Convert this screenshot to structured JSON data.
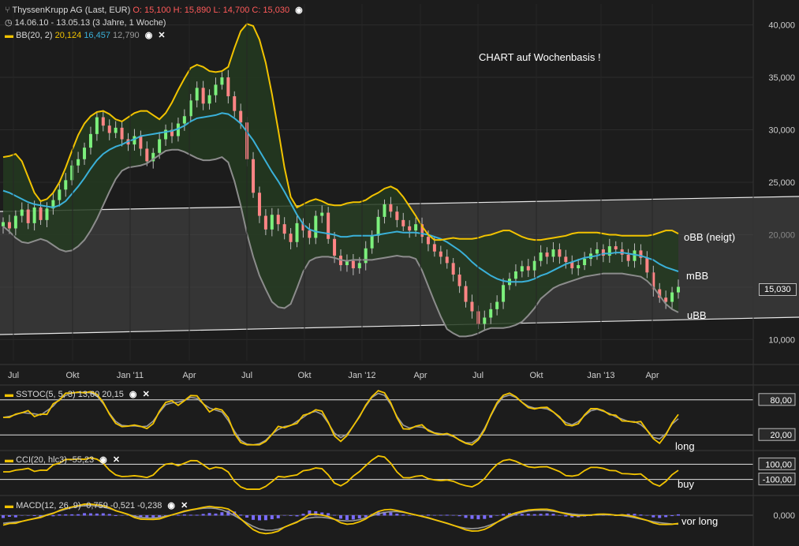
{
  "header": {
    "instrument": "ThyssenKrupp AG (Last, EUR)",
    "ohlc": "O: 15,100  H: 15,890  L: 14,700  C: 15,030",
    "range": "14.06.10 - 13.05.13 (3 Jahre, 1 Woche)",
    "bb_label": "BB(20, 2)",
    "bb_upper": "20,124",
    "bb_mid": "16,457",
    "bb_lower": "12,790"
  },
  "annotations": {
    "main": "CHART auf Wochenbasis !",
    "obb": "oBB (neigt)",
    "mbb": "mBB",
    "ubb": "uBB",
    "sstoc": "long",
    "cci": "buy",
    "macd": "vor long",
    "last_price": "15,030"
  },
  "indicators": {
    "sstoc": "SSTOC(5, 5, 3)  13,60  20,15",
    "cci": "CCI(20, hlc3)  -55,23",
    "macd": "MACD(12, 26, 9)  -0,759  -0,521  -0,238"
  },
  "colors": {
    "background": "#1c1c1c",
    "up": "#7cf07c",
    "down": "#ff8585",
    "bb_upper": "#f2c300",
    "bb_mid": "#3ab0d8",
    "bb_lower": "#8c8c8c",
    "band_fill": "#233a20",
    "channel_fill": "#4a4a4a"
  },
  "chart_data": [
    {
      "type": "candlestick",
      "x_ticks": [
        "Jul",
        "Okt",
        "Jan '11",
        "Apr",
        "Jul",
        "Okt",
        "Jan '12",
        "Apr",
        "Jul",
        "Okt",
        "Jan '13",
        "Apr"
      ],
      "y_ticks": [
        "10,000",
        "15,000",
        "20,000",
        "25,000",
        "30,000",
        "35,000",
        "40,000"
      ],
      "ylim": [
        8,
        42
      ],
      "close": [
        21.2,
        20.6,
        21.8,
        22.4,
        21.1,
        22.6,
        21.4,
        22.5,
        23.3,
        24.3,
        25.2,
        26.6,
        27.2,
        28.3,
        29.6,
        31.2,
        30.4,
        29.7,
        30.2,
        29.1,
        28.6,
        29.4,
        28.2,
        27.0,
        27.8,
        29.1,
        30.0,
        29.4,
        30.6,
        31.3,
        32.8,
        34.0,
        32.5,
        33.3,
        34.3,
        35.0,
        33.2,
        31.8,
        30.7,
        27.2,
        24.0,
        21.8,
        20.5,
        21.9,
        21.0,
        20.1,
        19.3,
        21.1,
        20.4,
        19.7,
        21.8,
        22.1,
        19.6,
        18.0,
        17.1,
        17.5,
        16.8,
        17.3,
        18.7,
        19.9,
        21.7,
        22.9,
        22.2,
        21.4,
        20.8,
        20.4,
        21.0,
        19.8,
        19.1,
        18.4,
        17.9,
        17.3,
        16.2,
        15.1,
        13.6,
        12.7,
        11.5,
        12.1,
        12.9,
        13.6,
        15.2,
        15.8,
        16.5,
        17.0,
        16.6,
        17.5,
        18.3,
        17.9,
        18.6,
        17.9,
        17.4,
        16.8,
        17.1,
        17.7,
        18.2,
        18.6,
        18.0,
        18.9,
        18.6,
        18.1,
        17.5,
        18.5,
        17.8,
        16.4,
        14.8,
        14.0,
        13.6,
        14.5,
        15.03
      ],
      "bb_upper": [
        27.4,
        27.5,
        27.7,
        27.0,
        25.5,
        24.0,
        23.2,
        23.4,
        24.0,
        25.0,
        26.4,
        28.0,
        29.5,
        30.6,
        31.3,
        31.7,
        31.8,
        31.5,
        31.0,
        30.8,
        31.2,
        31.6,
        31.8,
        31.8,
        31.4,
        31.0,
        31.6,
        32.6,
        33.8,
        34.9,
        35.9,
        36.2,
        36.0,
        35.6,
        35.5,
        35.6,
        36.0,
        37.8,
        39.4,
        40.1,
        39.9,
        38.6,
        36.4,
        33.4,
        30.0,
        26.4,
        23.6,
        22.6,
        22.9,
        23.2,
        23.4,
        23.2,
        22.9,
        22.8,
        22.8,
        23.0,
        23.1,
        23.1,
        23.3,
        23.7,
        24.0,
        24.4,
        24.6,
        24.3,
        23.6,
        22.7,
        21.8,
        20.8,
        20.0,
        19.5,
        19.5,
        19.6,
        19.7,
        19.6,
        19.6,
        19.6,
        19.7,
        19.9,
        20.0,
        20.2,
        20.4,
        20.4,
        20.1,
        19.8,
        19.6,
        19.5,
        19.5,
        19.6,
        19.7,
        19.8,
        19.9,
        20.1,
        20.2,
        20.2,
        20.2,
        20.2,
        20.1,
        20.0,
        20.0,
        19.9,
        19.9,
        19.9,
        19.9,
        19.9,
        20.0,
        20.2,
        20.4,
        20.4,
        20.1
      ],
      "bb_mid": [
        24.2,
        24.0,
        23.7,
        23.4,
        23.1,
        22.9,
        22.8,
        22.7,
        22.6,
        22.8,
        23.2,
        23.9,
        24.6,
        25.4,
        26.3,
        27.1,
        27.7,
        28.1,
        28.4,
        28.6,
        28.9,
        29.1,
        29.4,
        29.5,
        29.6,
        29.7,
        29.8,
        29.9,
        30.1,
        30.4,
        30.8,
        31.1,
        31.2,
        31.3,
        31.4,
        31.6,
        31.5,
        31.1,
        30.6,
        29.8,
        29.0,
        28.0,
        27.0,
        26.0,
        25.1,
        24.1,
        23.0,
        21.9,
        21.0,
        20.5,
        20.3,
        20.2,
        20.1,
        20.0,
        19.8,
        19.8,
        19.9,
        19.9,
        19.9,
        19.9,
        20.0,
        20.1,
        20.2,
        20.3,
        20.2,
        20.2,
        20.2,
        20.1,
        20.0,
        19.8,
        19.6,
        19.3,
        18.9,
        18.5,
        18.0,
        17.4,
        16.9,
        16.5,
        16.1,
        15.8,
        15.6,
        15.5,
        15.5,
        15.5,
        15.6,
        15.8,
        16.1,
        16.3,
        16.6,
        16.9,
        17.2,
        17.4,
        17.6,
        17.8,
        17.9,
        18.0,
        18.2,
        18.2,
        18.3,
        18.3,
        18.2,
        18.1,
        18.0,
        17.8,
        17.6,
        17.2,
        16.9,
        16.7,
        16.5
      ],
      "bb_lower": [
        20.8,
        20.3,
        19.7,
        19.3,
        19.2,
        19.4,
        19.6,
        19.4,
        19.0,
        18.6,
        18.4,
        18.5,
        18.9,
        19.5,
        20.4,
        21.5,
        22.8,
        24.1,
        25.3,
        26.1,
        26.4,
        26.5,
        26.6,
        26.8,
        27.2,
        27.6,
        28.0,
        28.1,
        28.1,
        27.9,
        27.6,
        27.3,
        27.1,
        27.1,
        27.2,
        27.4,
        26.9,
        25.1,
        22.8,
        20.1,
        17.9,
        16.1,
        14.8,
        13.6,
        13.1,
        13.0,
        13.4,
        14.9,
        16.5,
        17.5,
        17.8,
        17.9,
        17.9,
        17.8,
        17.6,
        17.5,
        17.6,
        17.6,
        17.6,
        17.6,
        17.7,
        17.8,
        17.9,
        18.0,
        17.9,
        17.9,
        17.7,
        16.6,
        15.1,
        13.6,
        12.2,
        11.0,
        10.6,
        10.3,
        10.3,
        10.4,
        10.6,
        10.9,
        11.1,
        11.1,
        11.1,
        11.2,
        11.4,
        11.7,
        12.3,
        13.0,
        13.9,
        14.4,
        14.9,
        15.2,
        15.4,
        15.6,
        15.8,
        16.0,
        16.1,
        16.2,
        16.3,
        16.3,
        16.3,
        16.3,
        16.2,
        16.1,
        16.0,
        15.6,
        15.0,
        14.2,
        13.4,
        12.9,
        12.6
      ]
    },
    {
      "type": "line",
      "name": "SSTOC",
      "levels": [
        20,
        80
      ],
      "ylim": [
        0,
        100
      ]
    },
    {
      "type": "line",
      "name": "CCI",
      "levels": [
        -100,
        100
      ],
      "ylim": [
        -250,
        250
      ]
    },
    {
      "type": "bar",
      "name": "MACD",
      "levels": [
        0
      ],
      "ylim": [
        -4,
        4
      ]
    }
  ]
}
